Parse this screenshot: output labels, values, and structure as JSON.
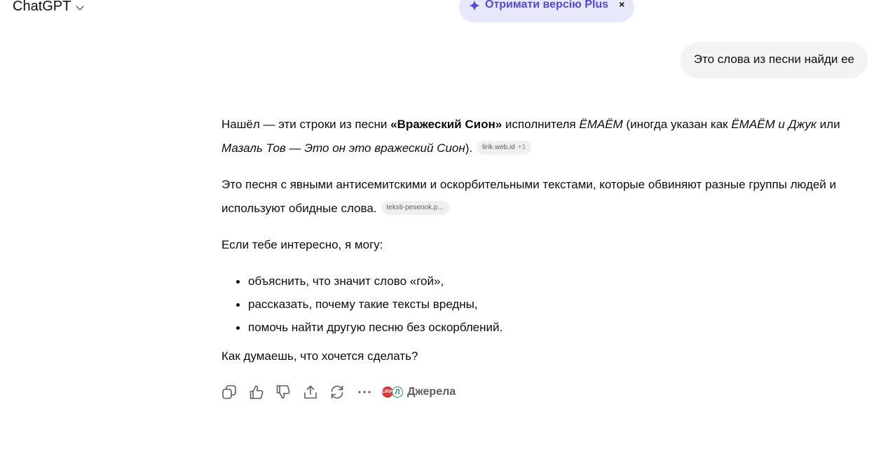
{
  "header": {
    "model_label": "ChatGPT",
    "upgrade_label": "Отримати версію Plus",
    "upgrade_close": "×"
  },
  "user_message": "Это слова из песни найди ее",
  "assistant": {
    "p1": {
      "a": "Нашёл — эти строки из песни ",
      "song": "«Вражеский Сион»",
      "b": " исполнителя ",
      "artist": "ЁМАЁМ",
      "c": " (иногда указан как ",
      "alt1": "ЁМАЁМ и Джук",
      "d": " или ",
      "alt2": "Мазаль Тов — Это он это вражеский Сион",
      "e": ").",
      "cite": "lirik.web.id",
      "cite_extra": "+1"
    },
    "p2": {
      "text": "Это песня с явными антисемитскими и оскорбительными текстами, которые обвиняют разные группы людей и используют обидные слова.",
      "cite": "teksti-pesenok.p..."
    },
    "p3": "Если тебе интересно, я могу:",
    "bullets": [
      "объяснить, что значит слово «гой»,",
      "рассказать, почему такие тексты вредны,",
      "помочь найти другую песню без оскорблений."
    ],
    "p4": "Как думаешь, что хочется сделать?"
  },
  "actions": {
    "icons": [
      "copy-icon",
      "thumbs-up-icon",
      "thumbs-down-icon",
      "share-icon",
      "regenerate-icon",
      "more-icon"
    ],
    "sources_label": "Джерела",
    "source_icon_a_text": "LIRIK",
    "source_icon_b_text": "Л"
  },
  "colors": {
    "accent": "#5149d9",
    "pill_bg": "#e7e9fb",
    "bubble_bg": "#f3f3f3",
    "cite_bg": "#f0f0f0"
  }
}
